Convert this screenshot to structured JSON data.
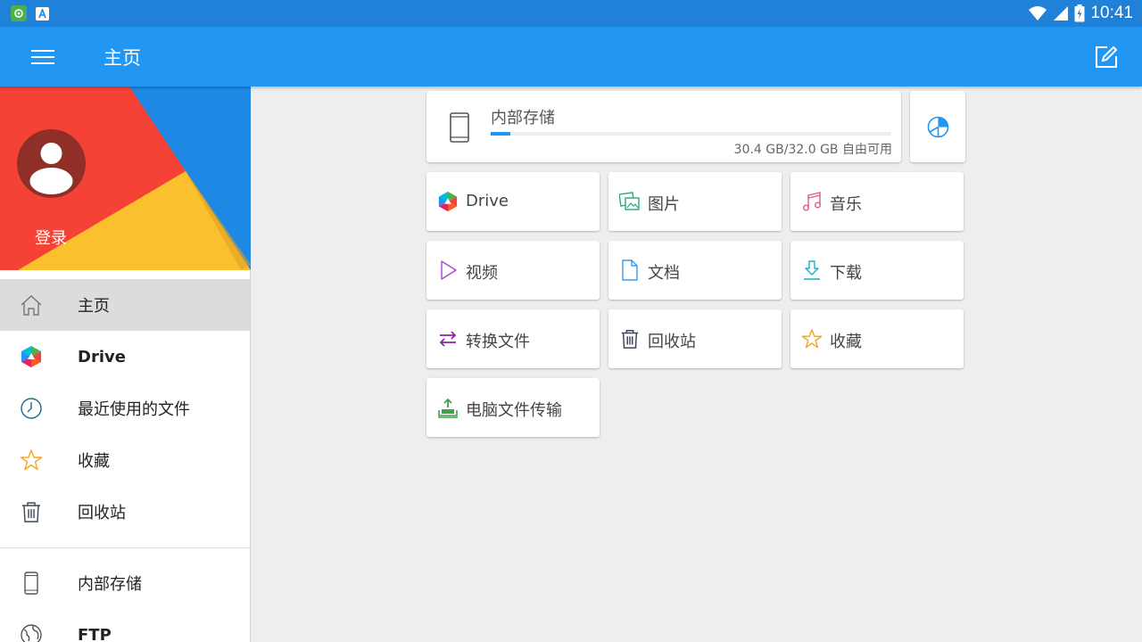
{
  "status_bar": {
    "time": "10:41",
    "left_icons": [
      "app-notification-icon",
      "font-notification-icon"
    ],
    "right_icons": [
      "wifi-icon",
      "signal-icon",
      "battery-icon"
    ]
  },
  "app_bar": {
    "title": "主页",
    "menu_icon": "hamburger-menu-icon",
    "action_icon": "edit-icon"
  },
  "drawer": {
    "login_label": "登录",
    "items": [
      {
        "label": "主页",
        "icon": "home-icon",
        "active": true
      },
      {
        "label": "Drive",
        "icon": "drive-icon",
        "bold": true
      },
      {
        "label": "最近使用的文件",
        "icon": "clock-icon"
      },
      {
        "label": "收藏",
        "icon": "star-icon"
      },
      {
        "label": "回收站",
        "icon": "trash-icon"
      }
    ],
    "secondary_items": [
      {
        "label": "内部存储",
        "icon": "phone-icon"
      },
      {
        "label": "FTP",
        "icon": "globe-icon",
        "bold": true
      }
    ]
  },
  "storage": {
    "title": "内部存储",
    "free_text": "30.4 GB/32.0 GB 自由可用",
    "used_fraction": 0.05
  },
  "tiles": [
    {
      "label": "Drive",
      "icon": "drive-icon"
    },
    {
      "label": "图片",
      "icon": "image-icon"
    },
    {
      "label": "音乐",
      "icon": "music-icon"
    },
    {
      "label": "视频",
      "icon": "video-icon"
    },
    {
      "label": "文档",
      "icon": "document-icon"
    },
    {
      "label": "下载",
      "icon": "download-icon"
    },
    {
      "label": "转换文件",
      "icon": "convert-icon"
    },
    {
      "label": "回收站",
      "icon": "trash-icon"
    },
    {
      "label": "收藏",
      "icon": "star-icon"
    },
    {
      "label": "电脑文件传输",
      "icon": "pc-transfer-icon"
    }
  ],
  "colors": {
    "status_bar": "#1f82d8",
    "app_bar": "#2196f3",
    "accent": "#2196f3",
    "header_red": "#f44336",
    "header_yellow": "#fbc02d",
    "header_blue": "#1e88e5"
  }
}
